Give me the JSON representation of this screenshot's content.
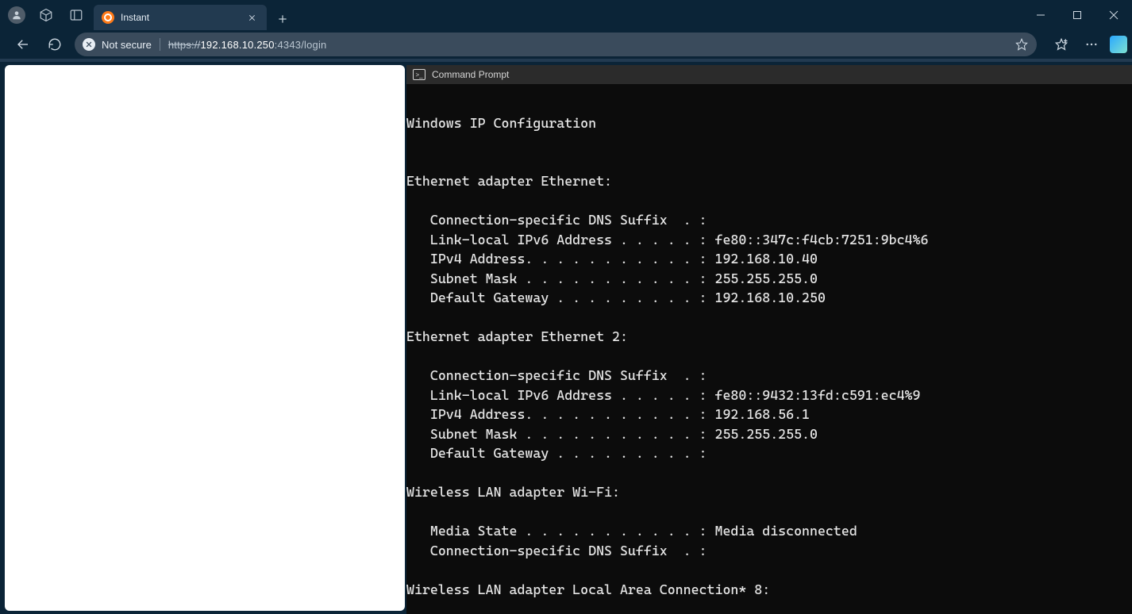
{
  "browser": {
    "tab": {
      "title": "Instant"
    },
    "toolbar": {
      "not_secure_label": "Not secure",
      "url_scheme": "https://",
      "url_host": "192.168.10.250",
      "url_port_path": ":4343/login"
    }
  },
  "cmd": {
    "title": "Command Prompt",
    "lines": [
      "",
      "Windows IP Configuration",
      "",
      "",
      "Ethernet adapter Ethernet:",
      "",
      "   Connection-specific DNS Suffix  . :",
      "   Link-local IPv6 Address . . . . . : fe80::347c:f4cb:7251:9bc4%6",
      "   IPv4 Address. . . . . . . . . . . : 192.168.10.40",
      "   Subnet Mask . . . . . . . . . . . : 255.255.255.0",
      "   Default Gateway . . . . . . . . . : 192.168.10.250",
      "",
      "Ethernet adapter Ethernet 2:",
      "",
      "   Connection-specific DNS Suffix  . :",
      "   Link-local IPv6 Address . . . . . : fe80::9432:13fd:c591:ec4%9",
      "   IPv4 Address. . . . . . . . . . . : 192.168.56.1",
      "   Subnet Mask . . . . . . . . . . . : 255.255.255.0",
      "   Default Gateway . . . . . . . . . :",
      "",
      "Wireless LAN adapter Wi-Fi:",
      "",
      "   Media State . . . . . . . . . . . : Media disconnected",
      "   Connection-specific DNS Suffix  . :",
      "",
      "Wireless LAN adapter Local Area Connection* 8:"
    ]
  }
}
